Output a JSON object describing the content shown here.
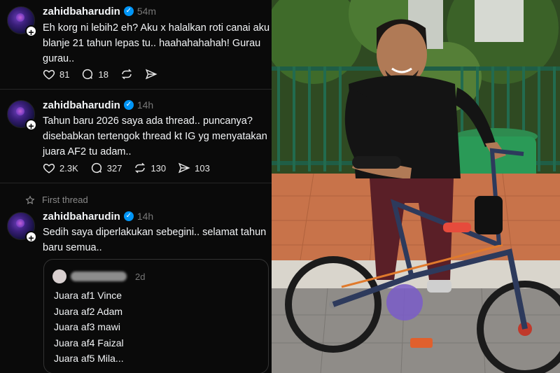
{
  "posts": [
    {
      "username": "zahidbaharudin",
      "time": "54m",
      "text": "Eh korg ni lebih2 eh? Aku x halalkan roti canai aku blanje 21 tahun lepas tu.. haahahahahah!  Gurau gurau..",
      "likes": "81",
      "replies": "18",
      "reposts": "",
      "shares": ""
    },
    {
      "username": "zahidbaharudin",
      "time": "14h",
      "text": "Tahun baru 2026 saya ada thread.. puncanya? disebabkan tertengok thread kt IG yg menyatakan juara AF2 tu adam..",
      "likes": "2.3K",
      "replies": "327",
      "reposts": "130",
      "shares": "103"
    },
    {
      "username": "zahidbaharudin",
      "time": "14h",
      "text": "Sedih saya diperlakukan sebegini.. selamat tahun baru semua..",
      "first_thread_label": "First thread"
    }
  ],
  "quote": {
    "time": "2d",
    "lines": [
      "Juara af1 Vince",
      "Juara af2 Adam",
      "Juara af3 mawi",
      "Juara af4 Faizal",
      "Juara af5 Mila..."
    ]
  },
  "colors": {
    "background": "#0a0a0a",
    "verified": "#0095f6",
    "divider": "#262626",
    "muted": "#777777"
  },
  "icons": [
    "heart-icon",
    "comment-icon",
    "repost-icon",
    "share-icon",
    "star-icon",
    "verified-icon",
    "follow-plus-icon"
  ]
}
